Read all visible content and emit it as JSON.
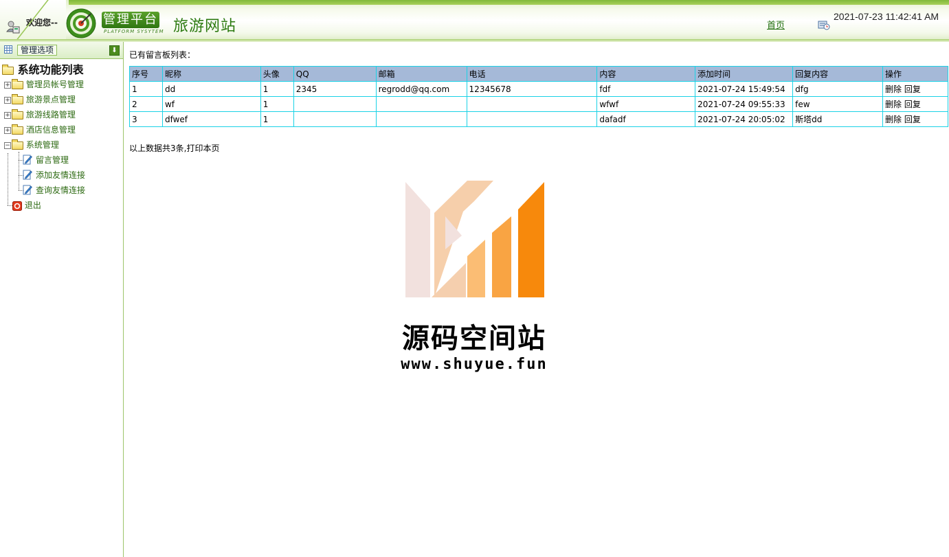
{
  "header": {
    "welcome": "欢迎您--",
    "platform_badge": "管理平台",
    "platform_sub": "PLATFORM SYSYTEM",
    "site_title": "旅游网站",
    "home_link": "首页",
    "datetime": "2021-07-23 11:42:41 AM"
  },
  "sidebar": {
    "head_label": "管理选项",
    "root_label": "系统功能列表",
    "items": [
      {
        "label": "管理员帐号管理"
      },
      {
        "label": "旅游景点管理"
      },
      {
        "label": "旅游线路管理"
      },
      {
        "label": "酒店信息管理"
      },
      {
        "label": "系统管理"
      }
    ],
    "sub_items": [
      {
        "label": "留言管理"
      },
      {
        "label": "添加友情连接"
      },
      {
        "label": "查询友情连接"
      }
    ],
    "logout": "退出"
  },
  "main": {
    "heading": "已有留言板列表：",
    "columns": [
      "序号",
      "昵称",
      "头像",
      "QQ",
      "邮箱",
      "电话",
      "内容",
      "添加时间",
      "回复内容",
      "操作"
    ],
    "rows": [
      {
        "id": "1",
        "nick": "dd",
        "avatar": "1",
        "qq": "2345",
        "email": "regrodd@qq.com",
        "phone": "12345678",
        "content": "fdf",
        "time": "2021-07-24 15:49:54",
        "reply": "dfg"
      },
      {
        "id": "2",
        "nick": "wf",
        "avatar": "1",
        "qq": "",
        "email": "",
        "phone": "",
        "content": "wfwf",
        "time": "2021-07-24 09:55:33",
        "reply": "few"
      },
      {
        "id": "3",
        "nick": "dfwef",
        "avatar": "1",
        "qq": "",
        "email": "",
        "phone": "",
        "content": "dafadf",
        "time": "2021-07-24 20:05:02",
        "reply": "斯塔dd"
      }
    ],
    "action_delete": "删除",
    "action_reply": "回复",
    "summary": "以上数据共3条,打印本页"
  },
  "watermark": {
    "title": "源码空间站",
    "url": "www.shuyue.fun"
  },
  "colors": {
    "brand_green": "#2c7a10",
    "table_header": "#a5b9d8",
    "table_border": "#19d2e6",
    "watermark_orange": "#f7890c"
  },
  "icons": [
    "user-icon",
    "logo-target-icon",
    "clock-icon",
    "grid-icon",
    "collapse-arrow-icon",
    "folder-icon",
    "expand-plus-icon",
    "collapse-minus-icon",
    "document-edit-icon",
    "exit-icon"
  ]
}
